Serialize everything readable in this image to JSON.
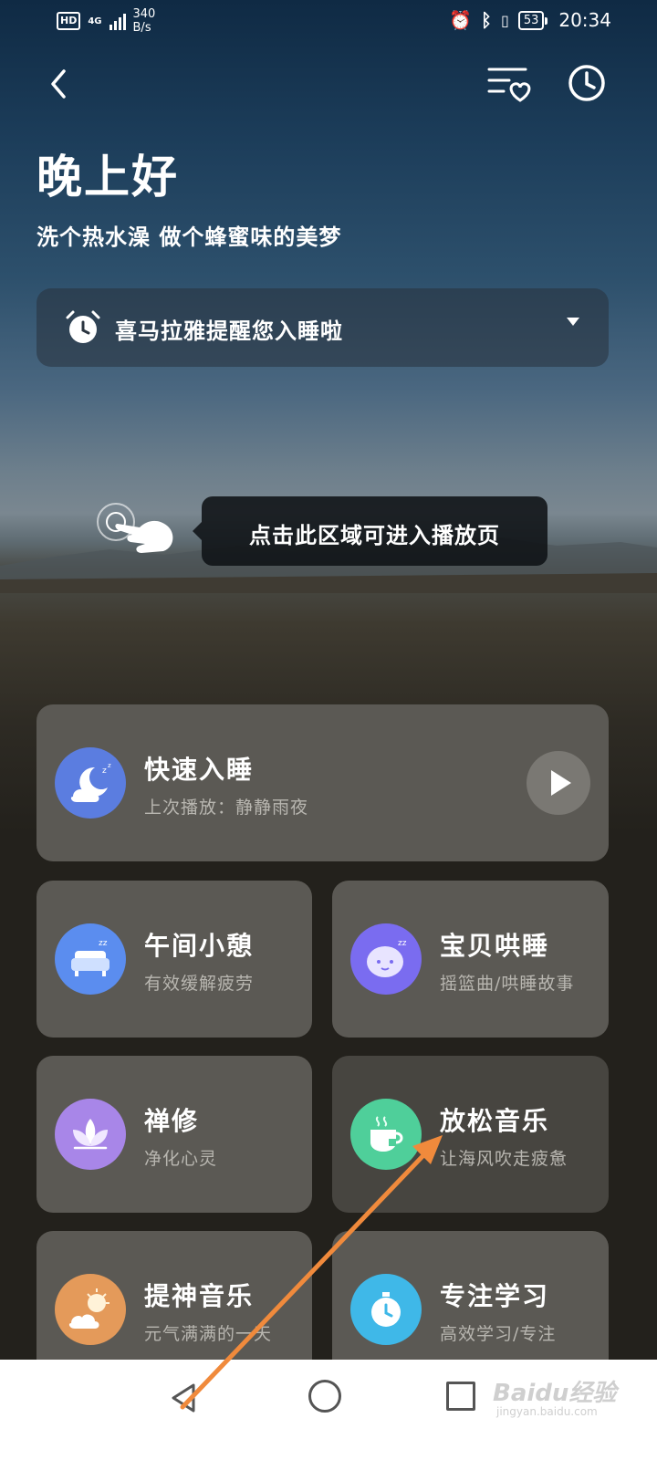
{
  "status_bar": {
    "hd": "HD",
    "network": "4G",
    "speed_value": "340",
    "speed_unit": "B/s",
    "battery": "53",
    "time": "20:34"
  },
  "header": {
    "greeting": "晚上好",
    "subtitle": "洗个热水澡 做个蜂蜜味的美梦"
  },
  "reminder": {
    "text": "喜马拉雅提醒您入睡啦"
  },
  "tooltip": {
    "text": "点击此区域可进入播放页"
  },
  "quick_sleep": {
    "title": "快速入睡",
    "desc": "上次播放：静静雨夜"
  },
  "cards": [
    {
      "title": "午间小憩",
      "desc": "有效缓解疲劳",
      "icon": "sofa-icon",
      "color": "#5b8def"
    },
    {
      "title": "宝贝哄睡",
      "desc": "摇篮曲/哄睡故事",
      "icon": "baby-icon",
      "color": "#7a6cf0"
    },
    {
      "title": "禅修",
      "desc": "净化心灵",
      "icon": "lotus-icon",
      "color": "#a886e8"
    },
    {
      "title": "放松音乐",
      "desc": "让海风吹走疲惫",
      "icon": "tea-cup-icon",
      "color": "#4fcf9a"
    },
    {
      "title": "提神音乐",
      "desc": "元气满满的一天",
      "icon": "sun-cloud-icon",
      "color": "#e49a5a"
    },
    {
      "title": "专注学习",
      "desc": "高效学习/专注",
      "icon": "stopwatch-icon",
      "color": "#3fb8e8"
    }
  ],
  "colors": {
    "moon_icon": "#5b7de0",
    "card_bg": "#5b5954",
    "arrow": "#f08a3c"
  },
  "watermark": {
    "main": "Baidu经验",
    "sub": "jingyan.baidu.com"
  }
}
